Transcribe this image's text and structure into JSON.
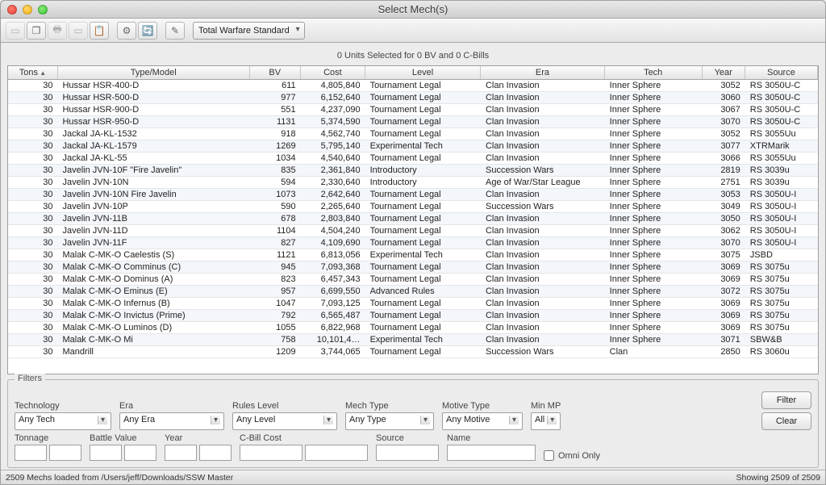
{
  "window": {
    "title": "Select Mech(s)"
  },
  "toolbar": {
    "dropdown": "Total Warfare Standard"
  },
  "status_top": "0 Units Selected for 0 BV and 0 C-Bills",
  "columns": [
    "Tons",
    "Type/Model",
    "BV",
    "Cost",
    "Level",
    "Era",
    "Tech",
    "Year",
    "Source"
  ],
  "rows": [
    {
      "tons": 30,
      "model": "Hussar HSR-400-D",
      "bv": 611,
      "cost": "4,805,840",
      "level": "Tournament Legal",
      "era": "Clan Invasion",
      "tech": "Inner Sphere",
      "year": 3052,
      "src": "RS 3050U-C"
    },
    {
      "tons": 30,
      "model": "Hussar HSR-500-D",
      "bv": 977,
      "cost": "6,152,640",
      "level": "Tournament Legal",
      "era": "Clan Invasion",
      "tech": "Inner Sphere",
      "year": 3060,
      "src": "RS 3050U-C"
    },
    {
      "tons": 30,
      "model": "Hussar HSR-900-D",
      "bv": 551,
      "cost": "4,237,090",
      "level": "Tournament Legal",
      "era": "Clan Invasion",
      "tech": "Inner Sphere",
      "year": 3067,
      "src": "RS 3050U-C"
    },
    {
      "tons": 30,
      "model": "Hussar HSR-950-D",
      "bv": 1131,
      "cost": "5,374,590",
      "level": "Tournament Legal",
      "era": "Clan Invasion",
      "tech": "Inner Sphere",
      "year": 3070,
      "src": "RS 3050U-C"
    },
    {
      "tons": 30,
      "model": "Jackal JA-KL-1532",
      "bv": 918,
      "cost": "4,562,740",
      "level": "Tournament Legal",
      "era": "Clan Invasion",
      "tech": "Inner Sphere",
      "year": 3052,
      "src": "RS 3055Uu"
    },
    {
      "tons": 30,
      "model": "Jackal JA-KL-1579",
      "bv": 1269,
      "cost": "5,795,140",
      "level": "Experimental Tech",
      "era": "Clan Invasion",
      "tech": "Inner Sphere",
      "year": 3077,
      "src": "XTRMarik"
    },
    {
      "tons": 30,
      "model": "Jackal JA-KL-55",
      "bv": 1034,
      "cost": "4,540,640",
      "level": "Tournament Legal",
      "era": "Clan Invasion",
      "tech": "Inner Sphere",
      "year": 3066,
      "src": "RS 3055Uu"
    },
    {
      "tons": 30,
      "model": "Javelin JVN-10F \"Fire Javelin\"",
      "bv": 835,
      "cost": "2,361,840",
      "level": "Introductory",
      "era": "Succession Wars",
      "tech": "Inner Sphere",
      "year": 2819,
      "src": "RS 3039u"
    },
    {
      "tons": 30,
      "model": "Javelin JVN-10N",
      "bv": 594,
      "cost": "2,330,640",
      "level": "Introductory",
      "era": "Age of War/Star League",
      "tech": "Inner Sphere",
      "year": 2751,
      "src": "RS 3039u"
    },
    {
      "tons": 30,
      "model": "Javelin JVN-10N Fire Javelin",
      "bv": 1073,
      "cost": "2,642,640",
      "level": "Tournament Legal",
      "era": "Clan Invasion",
      "tech": "Inner Sphere",
      "year": 3053,
      "src": "RS 3050U-I"
    },
    {
      "tons": 30,
      "model": "Javelin JVN-10P",
      "bv": 590,
      "cost": "2,265,640",
      "level": "Tournament Legal",
      "era": "Succession Wars",
      "tech": "Inner Sphere",
      "year": 3049,
      "src": "RS 3050U-I"
    },
    {
      "tons": 30,
      "model": "Javelin JVN-11B",
      "bv": 678,
      "cost": "2,803,840",
      "level": "Tournament Legal",
      "era": "Clan Invasion",
      "tech": "Inner Sphere",
      "year": 3050,
      "src": "RS 3050U-I"
    },
    {
      "tons": 30,
      "model": "Javelin JVN-11D",
      "bv": 1104,
      "cost": "4,504,240",
      "level": "Tournament Legal",
      "era": "Clan Invasion",
      "tech": "Inner Sphere",
      "year": 3062,
      "src": "RS 3050U-I"
    },
    {
      "tons": 30,
      "model": "Javelin JVN-11F",
      "bv": 827,
      "cost": "4,109,690",
      "level": "Tournament Legal",
      "era": "Clan Invasion",
      "tech": "Inner Sphere",
      "year": 3070,
      "src": "RS 3050U-I"
    },
    {
      "tons": 30,
      "model": "Malak C-MK-O Caelestis (S)",
      "bv": 1121,
      "cost": "6,813,056",
      "level": "Experimental Tech",
      "era": "Clan Invasion",
      "tech": "Inner Sphere",
      "year": 3075,
      "src": "JSBD"
    },
    {
      "tons": 30,
      "model": "Malak C-MK-O Comminus (C)",
      "bv": 945,
      "cost": "7,093,368",
      "level": "Tournament Legal",
      "era": "Clan Invasion",
      "tech": "Inner Sphere",
      "year": 3069,
      "src": "RS 3075u"
    },
    {
      "tons": 30,
      "model": "Malak C-MK-O Dominus (A)",
      "bv": 823,
      "cost": "6,457,343",
      "level": "Tournament Legal",
      "era": "Clan Invasion",
      "tech": "Inner Sphere",
      "year": 3069,
      "src": "RS 3075u"
    },
    {
      "tons": 30,
      "model": "Malak C-MK-O Eminus (E)",
      "bv": 957,
      "cost": "6,699,550",
      "level": "Advanced Rules",
      "era": "Clan Invasion",
      "tech": "Inner Sphere",
      "year": 3072,
      "src": "RS 3075u"
    },
    {
      "tons": 30,
      "model": "Malak C-MK-O Infernus (B)",
      "bv": 1047,
      "cost": "7,093,125",
      "level": "Tournament Legal",
      "era": "Clan Invasion",
      "tech": "Inner Sphere",
      "year": 3069,
      "src": "RS 3075u"
    },
    {
      "tons": 30,
      "model": "Malak C-MK-O Invictus (Prime)",
      "bv": 792,
      "cost": "6,565,487",
      "level": "Tournament Legal",
      "era": "Clan Invasion",
      "tech": "Inner Sphere",
      "year": 3069,
      "src": "RS 3075u"
    },
    {
      "tons": 30,
      "model": "Malak C-MK-O Luminos (D)",
      "bv": 1055,
      "cost": "6,822,968",
      "level": "Tournament Legal",
      "era": "Clan Invasion",
      "tech": "Inner Sphere",
      "year": 3069,
      "src": "RS 3075u"
    },
    {
      "tons": 30,
      "model": "Malak C-MK-O Mi",
      "bv": 758,
      "cost": "10,101,4…",
      "level": "Experimental Tech",
      "era": "Clan Invasion",
      "tech": "Inner Sphere",
      "year": 3071,
      "src": "SBW&B"
    },
    {
      "tons": 30,
      "model": "Mandrill",
      "bv": 1209,
      "cost": "3,744,065",
      "level": "Tournament Legal",
      "era": "Succession Wars",
      "tech": "Clan",
      "year": 2850,
      "src": "RS 3060u"
    }
  ],
  "filters": {
    "legend": "Filters",
    "labels": {
      "technology": "Technology",
      "era": "Era",
      "rules": "Rules Level",
      "mechtype": "Mech Type",
      "motive": "Motive Type",
      "minmp": "Min MP",
      "tonnage": "Tonnage",
      "bv": "Battle Value",
      "year": "Year",
      "cbill": "C-Bill Cost",
      "source": "Source",
      "name": "Name",
      "omni": "Omni Only"
    },
    "values": {
      "technology": "Any Tech",
      "era": "Any Era",
      "rules": "Any Level",
      "mechtype": "Any Type",
      "motive": "Any Motive",
      "minmp": "All"
    },
    "buttons": {
      "filter": "Filter",
      "clear": "Clear"
    }
  },
  "statusbar": {
    "left": "2509 Mechs loaded from /Users/jeff/Downloads/SSW Master",
    "right": "Showing 2509 of 2509"
  }
}
